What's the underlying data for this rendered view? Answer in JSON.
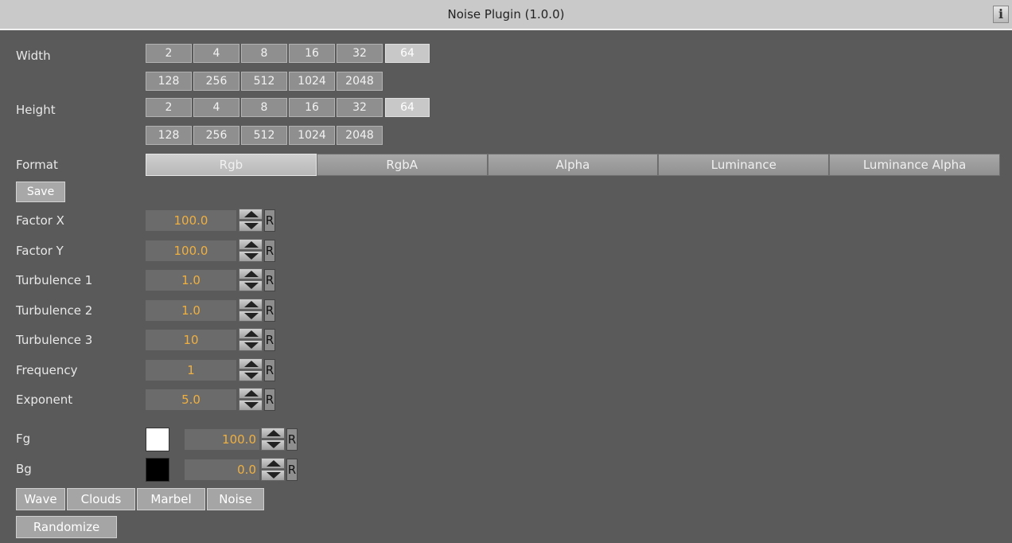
{
  "window": {
    "title": "Noise Plugin (1.0.0)",
    "info_label": "i"
  },
  "width": {
    "label": "Width",
    "row1": [
      "2",
      "4",
      "8",
      "16",
      "32",
      "64"
    ],
    "row2": [
      "128",
      "256",
      "512",
      "1024",
      "2048"
    ],
    "selected": "64"
  },
  "height": {
    "label": "Height",
    "row1": [
      "2",
      "4",
      "8",
      "16",
      "32",
      "64"
    ],
    "row2": [
      "128",
      "256",
      "512",
      "1024",
      "2048"
    ],
    "selected": "64"
  },
  "format": {
    "label": "Format",
    "options": [
      "Rgb",
      "RgbA",
      "Alpha",
      "Luminance",
      "Luminance Alpha"
    ],
    "selected": "Rgb"
  },
  "save_label": "Save",
  "params": [
    {
      "label": "Factor X",
      "value": "100.0"
    },
    {
      "label": "Factor Y",
      "value": "100.0"
    },
    {
      "label": "Turbulence 1",
      "value": "1.0"
    },
    {
      "label": "Turbulence 2",
      "value": "1.0"
    },
    {
      "label": "Turbulence 3",
      "value": "10"
    },
    {
      "label": "Frequency",
      "value": "1"
    },
    {
      "label": "Exponent",
      "value": "5.0"
    }
  ],
  "colors": [
    {
      "label": "Fg",
      "swatch": "#ffffff",
      "value": "100.0"
    },
    {
      "label": "Bg",
      "swatch": "#000000",
      "value": "0.0"
    }
  ],
  "reset_label": "R",
  "types": [
    "Wave",
    "Clouds",
    "Marbel",
    "Noise"
  ],
  "randomize_label": "Randomize",
  "accent": "#f0b040"
}
